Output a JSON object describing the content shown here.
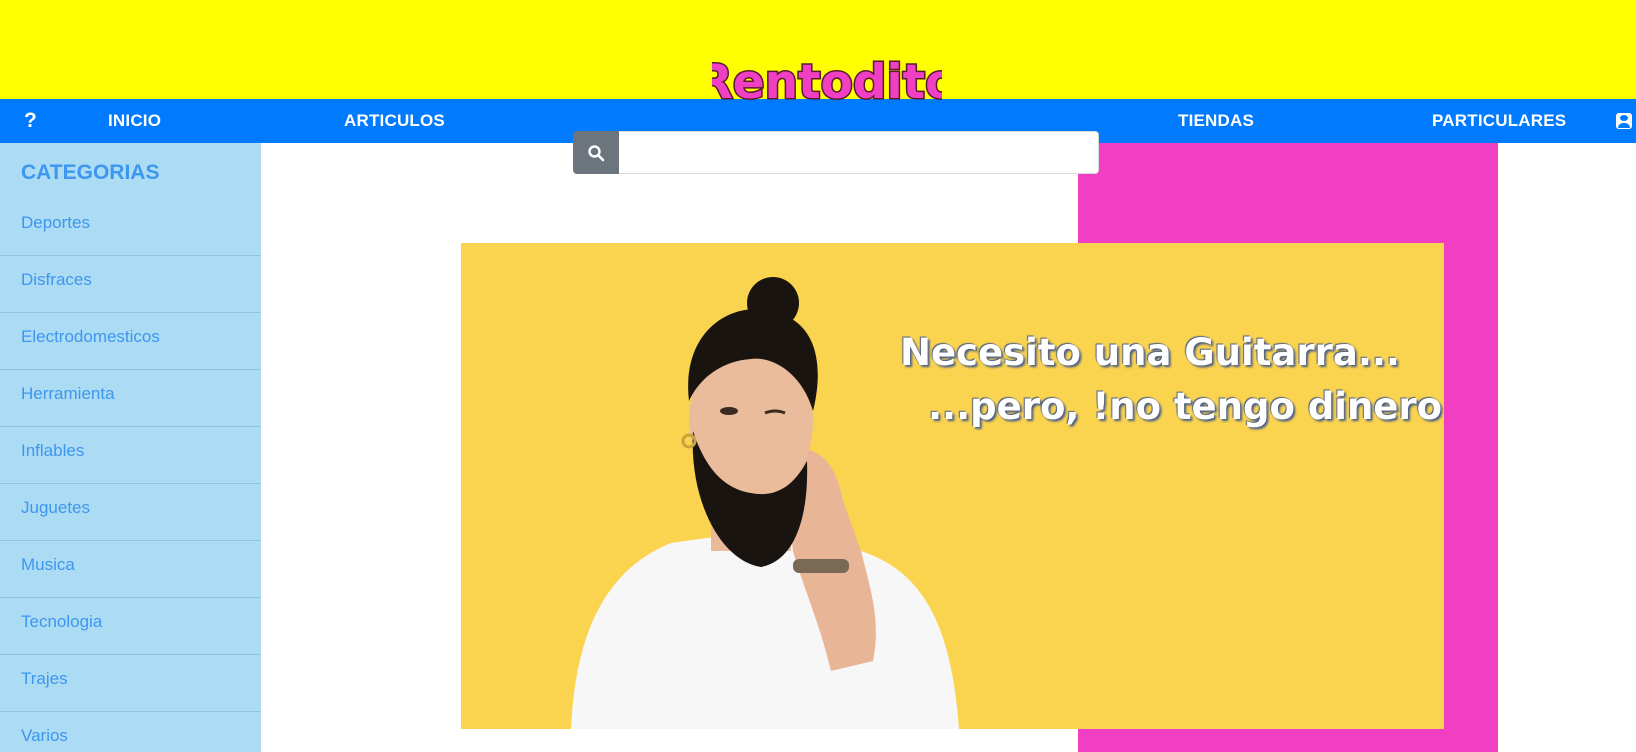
{
  "logo": {
    "text": "Rentodito",
    "colors": {
      "fill": "#f03fc3",
      "outline": "#5a1a2e"
    }
  },
  "nav": {
    "help_label": "?",
    "inicio_label": "INICIO",
    "articulos_label": "ARTICULOS",
    "tiendas_label": "TIENDAS",
    "particulares_label": "PARTICULARES",
    "user_icon": "user-card-icon"
  },
  "search": {
    "icon": "search-icon",
    "value": "",
    "placeholder": ""
  },
  "sidebar": {
    "title": "CATEGORIAS",
    "items": [
      {
        "label": "Deportes"
      },
      {
        "label": "Disfraces"
      },
      {
        "label": "Electrodomesticos"
      },
      {
        "label": "Herramienta"
      },
      {
        "label": "Inflables"
      },
      {
        "label": "Juguetes"
      },
      {
        "label": "Musica"
      },
      {
        "label": "Tecnologia"
      },
      {
        "label": "Trajes"
      },
      {
        "label": "Varios"
      }
    ]
  },
  "banner": {
    "line1": "Necesito una Guitarra...",
    "line2": "...pero, !no tengo dinero!"
  },
  "colors": {
    "top_bar": "#ffff00",
    "nav_bar": "#007bff",
    "sidebar_bg": "#acdcf3",
    "sidebar_text": "#3d96f0",
    "pink_panel": "#f03fc3",
    "banner_bg": "#fad44f",
    "search_button": "#6c757d"
  }
}
